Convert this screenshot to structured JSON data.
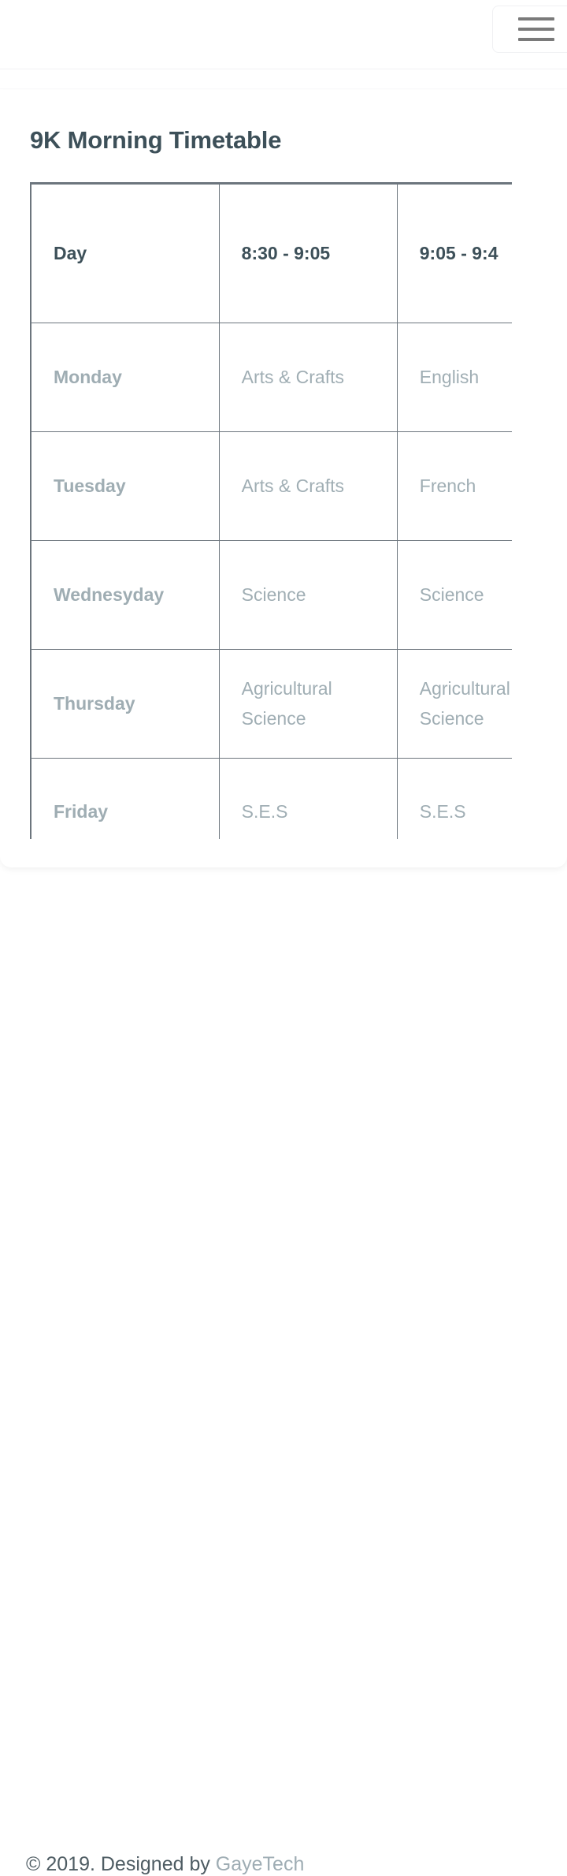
{
  "navbar": {
    "toggler": {
      "name": "hamburger-menu-button",
      "aria_label": "Toggle navigation"
    }
  },
  "main": {
    "page_title": "9K Morning Timetable",
    "timetable": {
      "columns": [
        "Day",
        "8:30 - 9:05",
        "9:05 - 9:4"
      ],
      "rows": [
        {
          "day": "Monday",
          "slot1": "Arts & Crafts",
          "slot2": "English"
        },
        {
          "day": "Tuesday",
          "slot1": "Arts & Crafts",
          "slot2": "French"
        },
        {
          "day": "Wednesyday",
          "slot1": "Science",
          "slot2": "Science"
        },
        {
          "day": "Thursday",
          "slot1": "Agricultural Science",
          "slot2": "Agricultural Science"
        },
        {
          "day": "Friday",
          "slot1": "S.E.S",
          "slot2": "S.E.S"
        }
      ]
    }
  },
  "footer": {
    "copyright_prefix": "© 2019. Designed by ",
    "brand": "GayeTech"
  },
  "colors": {
    "title": "#3d5059",
    "muted_text": "#a0aeb4",
    "table_border": "#6c757d",
    "hamburger_bar": "#7a7a7a",
    "page_background": "#ffffff",
    "footer_text": "#4e5c63",
    "brand_link": "#9fadb4"
  }
}
